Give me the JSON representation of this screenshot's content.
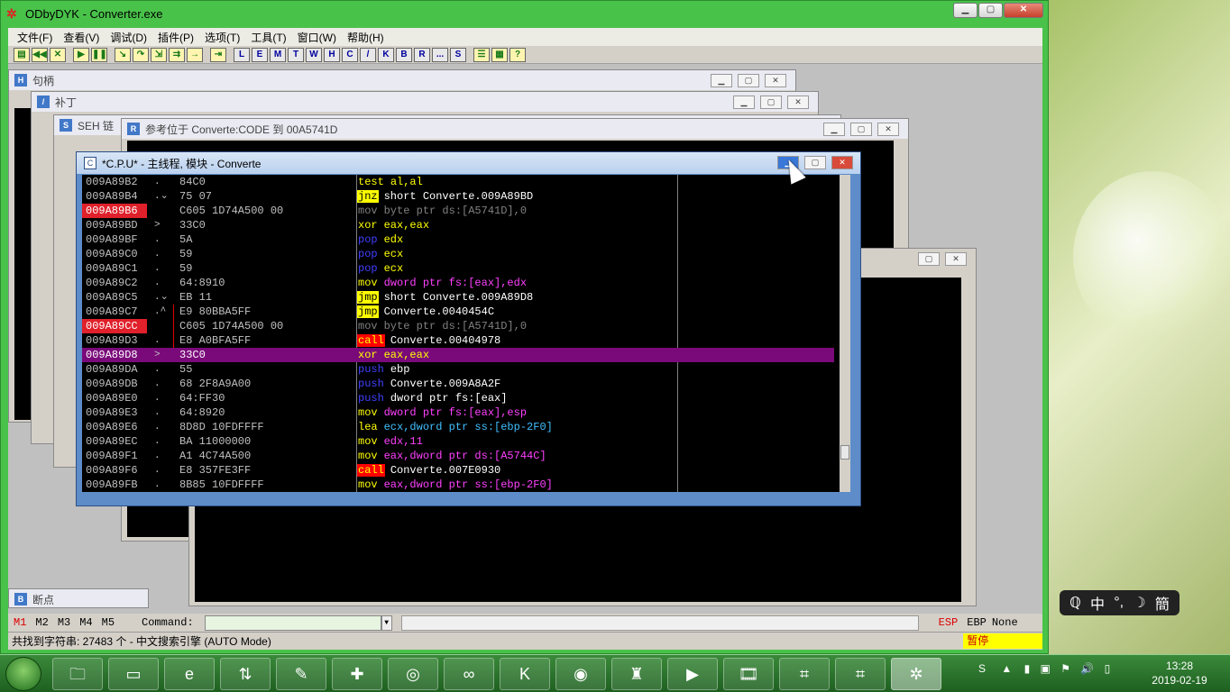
{
  "app": {
    "title": "ODbyDYK - Converter.exe"
  },
  "menu": [
    "文件(F)",
    "查看(V)",
    "调试(D)",
    "插件(P)",
    "选项(T)",
    "工具(T)",
    "窗口(W)",
    "帮助(H)"
  ],
  "toolbar": {
    "letters": [
      "L",
      "E",
      "M",
      "T",
      "W",
      "H",
      "C",
      "/",
      "K",
      "B",
      "R",
      "...",
      "S"
    ]
  },
  "windows": {
    "handles": "句柄",
    "patches": "补丁",
    "seh": "SEH 链",
    "refs": "参考位于 Converte:CODE 到 00A5741D",
    "breakpoints": "断点"
  },
  "cpu": {
    "title": "*C.P.U* - 主线程, 模块 - Converte",
    "rows": [
      {
        "addr": "009A89B2",
        "mark": ".",
        "hex": "84C0",
        "op": "test",
        "args": "al,al",
        "addr_style": "normal",
        "op_style": "test"
      },
      {
        "addr": "009A89B4",
        "mark": ".⌄",
        "hex": "75 07",
        "op": "jnz",
        "args": "short Converte.009A89BD",
        "addr_style": "normal",
        "op_style": "jmp"
      },
      {
        "addr": "009A89B6",
        "mark": "",
        "hex": "C605 1D74A500 00",
        "op": "mov",
        "args": "byte ptr ds:[A5741D],0",
        "addr_style": "red",
        "op_style": "grey"
      },
      {
        "addr": "009A89BD",
        "mark": ">",
        "hex": "33C0",
        "op": "xor",
        "args": "eax,eax",
        "addr_style": "normal",
        "op_style": "xor"
      },
      {
        "addr": "009A89BF",
        "mark": ".",
        "hex": "5A",
        "op": "pop",
        "args": "edx",
        "addr_style": "normal",
        "op_style": "pop"
      },
      {
        "addr": "009A89C0",
        "mark": ".",
        "hex": "59",
        "op": "pop",
        "args": "ecx",
        "addr_style": "normal",
        "op_style": "pop"
      },
      {
        "addr": "009A89C1",
        "mark": ".",
        "hex": "59",
        "op": "pop",
        "args": "ecx",
        "addr_style": "normal",
        "op_style": "pop"
      },
      {
        "addr": "009A89C2",
        "mark": ".",
        "hex": "64:8910",
        "op": "mov",
        "args": "dword ptr fs:[eax],edx",
        "addr_style": "normal",
        "op_style": "mov"
      },
      {
        "addr": "009A89C5",
        "mark": ".⌄",
        "hex": "EB 11",
        "op": "jmp",
        "args": "short Converte.009A89D8",
        "addr_style": "normal",
        "op_style": "jmp"
      },
      {
        "addr": "009A89C7",
        "mark": ".^",
        "hex": "E9 80BBA5FF",
        "op": "jmp",
        "args": "Converte.0040454C",
        "addr_style": "normal",
        "op_style": "jmp"
      },
      {
        "addr": "009A89CC",
        "mark": "",
        "hex": "C605 1D74A500 00",
        "op": "mov",
        "args": "byte ptr ds:[A5741D],0",
        "addr_style": "red",
        "op_style": "grey"
      },
      {
        "addr": "009A89D3",
        "mark": ".",
        "hex": "E8 A0BFA5FF",
        "op": "call",
        "args": "Converte.00404978",
        "addr_style": "normal",
        "op_style": "call"
      },
      {
        "addr": "009A89D8",
        "mark": ">",
        "hex": "33C0",
        "op": "xor",
        "args": "eax,eax",
        "addr_style": "sel",
        "op_style": "xor"
      },
      {
        "addr": "009A89DA",
        "mark": ".",
        "hex": "55",
        "op": "push",
        "args": "ebp",
        "addr_style": "normal",
        "op_style": "push"
      },
      {
        "addr": "009A89DB",
        "mark": ".",
        "hex": "68 2F8A9A00",
        "op": "push",
        "args": "Converte.009A8A2F",
        "addr_style": "normal",
        "op_style": "push"
      },
      {
        "addr": "009A89E0",
        "mark": ".",
        "hex": "64:FF30",
        "op": "push",
        "args": "dword ptr fs:[eax]",
        "addr_style": "normal",
        "op_style": "push"
      },
      {
        "addr": "009A89E3",
        "mark": ".",
        "hex": "64:8920",
        "op": "mov",
        "args": "dword ptr fs:[eax],esp",
        "addr_style": "normal",
        "op_style": "mov"
      },
      {
        "addr": "009A89E6",
        "mark": ".",
        "hex": "8D8D 10FDFFFF",
        "op": "lea",
        "args": "ecx,dword ptr ss:[ebp-2F0]",
        "addr_style": "normal",
        "op_style": "lea"
      },
      {
        "addr": "009A89EC",
        "mark": ".",
        "hex": "BA 11000000",
        "op": "mov",
        "args": "edx,11",
        "addr_style": "normal",
        "op_style": "mov"
      },
      {
        "addr": "009A89F1",
        "mark": ".",
        "hex": "A1 4C74A500",
        "op": "mov",
        "args": "eax,dword ptr ds:[A5744C]",
        "addr_style": "normal",
        "op_style": "mov"
      },
      {
        "addr": "009A89F6",
        "mark": ".",
        "hex": "E8 357FE3FF",
        "op": "call",
        "args": "Converte.007E0930",
        "addr_style": "normal",
        "op_style": "call"
      },
      {
        "addr": "009A89FB",
        "mark": ".",
        "hex": "8B85 10FDFFFF",
        "op": "mov",
        "args": "eax,dword ptr ss:[ebp-2F0]",
        "addr_style": "normal",
        "op_style": "mov"
      }
    ]
  },
  "cmdbar": {
    "m": [
      "M1",
      "M2",
      "M3",
      "M4",
      "M5"
    ],
    "label": "Command:",
    "value": "",
    "regs": [
      "ESP",
      "EBP",
      "None"
    ]
  },
  "status": {
    "text": "共找到字符串: 27483 个 - 中文搜索引擎 (AUTO Mode)",
    "state": "暂停"
  },
  "ime": {
    "a": "ℚ",
    "b": "中",
    "c": "°,",
    "d": "☽",
    "e": "簡"
  },
  "clock": {
    "time": "13:28",
    "date": "2019-02-19"
  },
  "taskbar": {
    "apps": [
      "explorer",
      "computer",
      "ie",
      "sync",
      "tool",
      "tool2",
      "net",
      "baidu",
      "k",
      "firefox",
      "castle",
      "media",
      "video",
      "od1",
      "od2",
      "od3"
    ]
  }
}
